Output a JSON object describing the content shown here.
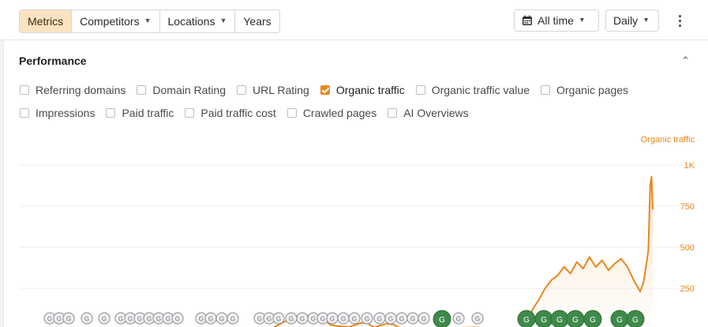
{
  "toolbar": {
    "segments": [
      {
        "label": "Metrics",
        "active": true,
        "dropdown": false
      },
      {
        "label": "Competitors",
        "active": false,
        "dropdown": true
      },
      {
        "label": "Locations",
        "active": false,
        "dropdown": true
      },
      {
        "label": "Years",
        "active": false,
        "dropdown": false
      }
    ],
    "range_label": "All time",
    "interval_label": "Daily",
    "calendar_icon": "calendar-icon",
    "more_icon": "kebab-menu-icon"
  },
  "performance": {
    "title": "Performance",
    "collapse_icon": "chevron-up-icon",
    "metrics_row1": [
      {
        "label": "Referring domains",
        "checked": false
      },
      {
        "label": "Domain Rating",
        "checked": false
      },
      {
        "label": "URL Rating",
        "checked": false
      },
      {
        "label": "Organic traffic",
        "checked": true
      },
      {
        "label": "Organic traffic value",
        "checked": false
      },
      {
        "label": "Organic pages",
        "checked": false
      }
    ],
    "metrics_row2": [
      {
        "label": "Impressions",
        "checked": false
      },
      {
        "label": "Paid traffic",
        "checked": false
      },
      {
        "label": "Paid traffic cost",
        "checked": false
      },
      {
        "label": "Crawled pages",
        "checked": false
      },
      {
        "label": "AI Overviews",
        "checked": false
      }
    ]
  },
  "chart_data": {
    "type": "area",
    "series": [
      {
        "name": "Organic traffic",
        "color": "#e8871e",
        "points": [
          [
            0,
            0
          ],
          [
            5,
            0
          ],
          [
            10,
            0
          ],
          [
            15,
            0
          ],
          [
            20,
            0
          ],
          [
            25,
            0
          ],
          [
            30,
            0
          ],
          [
            33,
            0
          ],
          [
            34,
            6
          ],
          [
            36,
            8
          ],
          [
            38,
            4
          ],
          [
            40,
            10
          ],
          [
            42,
            50
          ],
          [
            43,
            70
          ],
          [
            44,
            85
          ],
          [
            45,
            90
          ],
          [
            46,
            78
          ],
          [
            47,
            88
          ],
          [
            48,
            60
          ],
          [
            49,
            30
          ],
          [
            50,
            20
          ],
          [
            52,
            15
          ],
          [
            54,
            40
          ],
          [
            55,
            35
          ],
          [
            56,
            12
          ],
          [
            58,
            35
          ],
          [
            59,
            30
          ],
          [
            60,
            10
          ],
          [
            62,
            5
          ],
          [
            65,
            3
          ],
          [
            70,
            10
          ],
          [
            72,
            12
          ],
          [
            75,
            5
          ],
          [
            80,
            8
          ],
          [
            81,
            120
          ],
          [
            82,
            180
          ],
          [
            83,
            250
          ],
          [
            84,
            300
          ],
          [
            85,
            330
          ],
          [
            86,
            380
          ],
          [
            87,
            340
          ],
          [
            88,
            410
          ],
          [
            89,
            370
          ],
          [
            90,
            440
          ],
          [
            91,
            380
          ],
          [
            92,
            420
          ],
          [
            93,
            360
          ],
          [
            94,
            400
          ],
          [
            95,
            430
          ],
          [
            96,
            380
          ],
          [
            97,
            300
          ],
          [
            98,
            230
          ],
          [
            98.5,
            280
          ],
          [
            99,
            400
          ],
          [
            99.3,
            480
          ],
          [
            99.6,
            880
          ],
          [
            99.8,
            930
          ],
          [
            100,
            730
          ]
        ]
      }
    ],
    "ylim": [
      0,
      1000
    ],
    "y_ticks": [
      "250",
      "500",
      "750",
      "1K"
    ],
    "y_tick_values": [
      250,
      500,
      750,
      1000
    ],
    "axis_title": "Organic traffic",
    "grid": true,
    "markers": {
      "letter": "G",
      "gray_count": 34,
      "green_count": 8
    }
  }
}
